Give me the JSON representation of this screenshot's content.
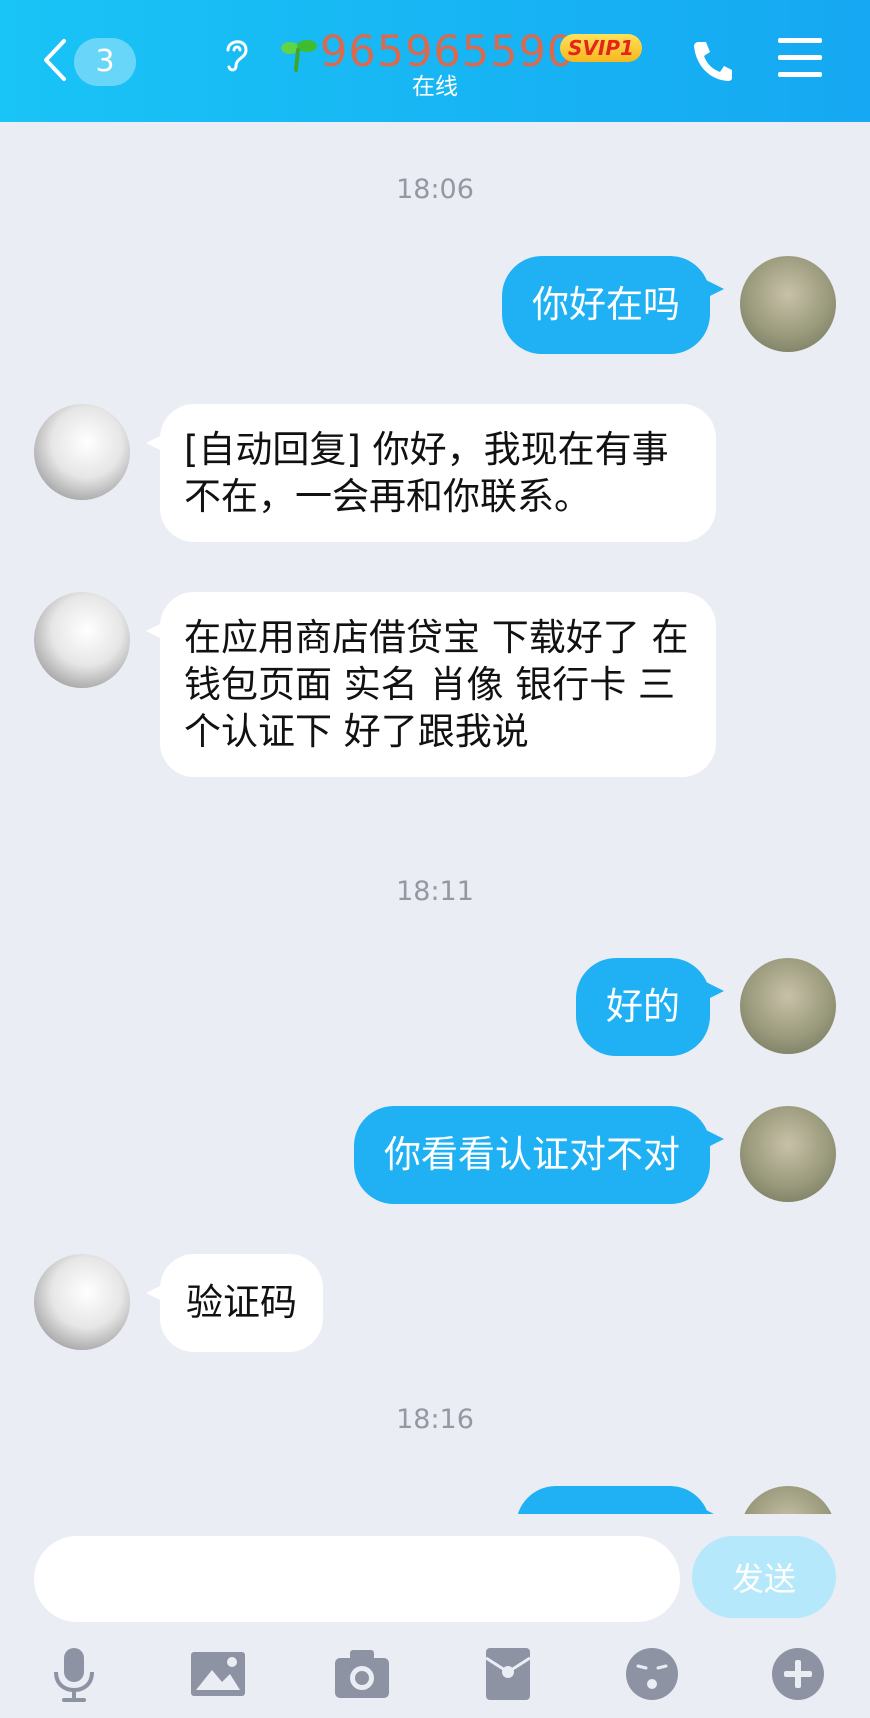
{
  "header": {
    "unread_count": "3",
    "contact_name": "965965590",
    "vip_badge": "SVIP1",
    "status": "在线"
  },
  "messages": [
    {
      "type": "time",
      "text": "18:06"
    },
    {
      "type": "sent",
      "text": "你好在吗"
    },
    {
      "type": "received",
      "text": "[自动回复] 你好，我现在有事不在，一会再和你联系。"
    },
    {
      "type": "received",
      "text": "在应用商店借贷宝 下载好了 在钱包页面 实名 肖像 银行卡 三个认证下 好了跟我说"
    },
    {
      "type": "time",
      "text": "18:11"
    },
    {
      "type": "sent",
      "text": "好的"
    },
    {
      "type": "sent",
      "text": "你看看认证对不对"
    },
    {
      "type": "received",
      "text": "验证码"
    },
    {
      "type": "time",
      "text": "18:16"
    }
  ],
  "input": {
    "value": "",
    "send_label": "发送"
  },
  "toolbar": [
    "mic-icon",
    "image-icon",
    "camera-icon",
    "red-packet-icon",
    "emoji-icon",
    "plus-icon"
  ],
  "colors": {
    "header": "#16b4f4",
    "sent_bubble": "#1fb1f3",
    "received_bubble": "#ffffff",
    "background": "#ebedf5",
    "contact_name": "#d96a4f",
    "send_button": "#b5e8fb"
  }
}
